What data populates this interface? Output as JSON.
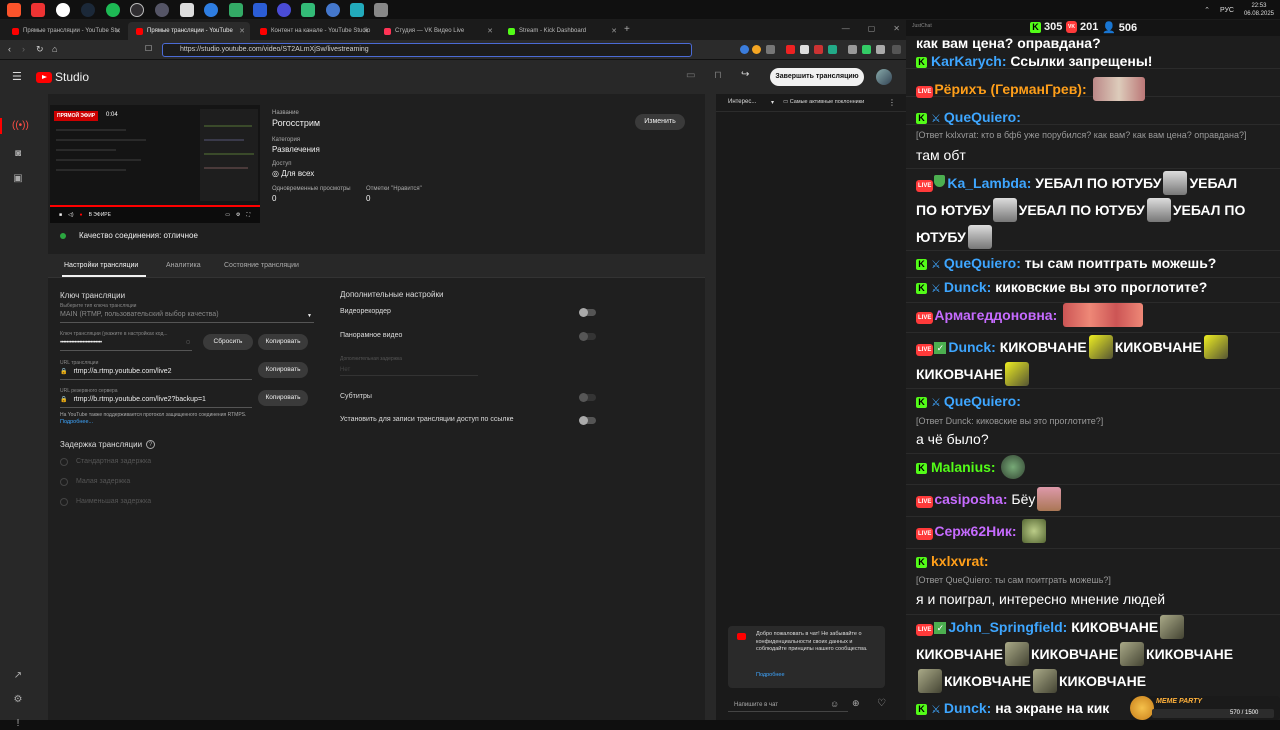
{
  "taskbar": {
    "lang": "РУС",
    "time": "22:53",
    "date": "06.08.2025"
  },
  "browser": {
    "tabs": [
      {
        "label": "Прямые трансляции - YouTube Stu",
        "active": false,
        "color": "#ff0000"
      },
      {
        "label": "Прямые трансляции - YouTube",
        "active": true,
        "color": "#ff0000"
      },
      {
        "label": "Контент на канале - YouTube Studio",
        "active": false,
        "color": "#ff0000"
      },
      {
        "label": "Студия — VK Видео Live",
        "active": false,
        "color": "#ff3355"
      },
      {
        "label": "Stream - Kick Dashboard",
        "active": false,
        "color": "#53fc18"
      }
    ],
    "url": "https://studio.youtube.com/video/ST2ALmXjSw/livestreaming"
  },
  "studio": {
    "logo_text": "Studio",
    "end_button": "Завершить трансляцию",
    "preview": {
      "badge": "ПРЯМОЙ ЭФИР",
      "time": "0:04",
      "live_label": "В ЭФИРЕ"
    },
    "info": {
      "title_label": "Название",
      "title": "Рогосстрим",
      "category_label": "Категория",
      "category": "Развлечения",
      "access_label": "Доступ",
      "access": "Для всех",
      "viewers_label": "Одновременные просмотры",
      "viewers": "0",
      "likes_label": "Отметки \"Нравится\"",
      "likes": "0"
    },
    "edit_button": "Изменить",
    "quality": "Качество соединения: отличное",
    "tabs": [
      "Настройки трансляции",
      "Аналитика",
      "Состояние трансляции"
    ],
    "key_section": {
      "title": "Ключ трансляции",
      "key_type_label": "Выберите тип ключа трансляции",
      "key_type": "MAIN (RTMP, пользовательский выбор качества)",
      "key_label": "Ключ трансляции (укажите в настройках код...",
      "key_value": "••••••••••••••••••••••••••",
      "reset_button": "Сбросить",
      "copy_button": "Копировать",
      "url_label": "URL трансляции",
      "url_value": "rtmp://a.rtmp.youtube.com/live2",
      "backup_label": "URL резервного сервера",
      "backup_value": "rtmp://b.rtmp.youtube.com/live2?backup=1",
      "rtmps_note": "На YouTube также поддерживается протокол защищенного соединения RTMPS.",
      "more_link": "Подробнее..."
    },
    "latency": {
      "title": "Задержка трансляции",
      "options": [
        "Стандартная задержка",
        "Малая задержка",
        "Наименьшая задержка"
      ]
    },
    "extra": {
      "title": "Дополнительные настройки",
      "dvr": "Видеорекордер",
      "panorama": "Панорамное видео",
      "delay_label": "Дополнительная задержка",
      "delay_value": "Нет",
      "subtitles": "Субтитры",
      "unlisted": "Установить для записи трансляции доступ по ссылке"
    },
    "chat": {
      "mode": "Интерес...",
      "top_fans": "Самые активные поклонники",
      "welcome": "Добро пожаловать в чат! Не забывайте о конфиденциальности своих данных и соблюдайте принципы нашего сообщества.",
      "welcome_link": "Подробнее",
      "input_placeholder": "Напишите в чат"
    }
  },
  "overlay": {
    "app": "JustChat",
    "kick_count": "305",
    "vk_count": "201",
    "yt_count": "506",
    "counter": "570 / 1500",
    "meme_party": "MEME PARTY",
    "colors": {
      "kick": "#53fc18",
      "kick_name": "#3ea6ff",
      "vk_name": "#c66bff",
      "orange": "#ff9f1a",
      "bg": "#1d1d1d"
    },
    "messages": [
      {
        "name": "",
        "text": "как вам цена? оправдана?"
      },
      {
        "name": "KarKarych:",
        "text": "Ссылки запрещены!"
      },
      {
        "name": "Рёрихъ (ГерманГрев):",
        "text": ""
      },
      {
        "name": "QueQuiero:",
        "text": ""
      },
      {
        "reply": "[Ответ kxlxvrat: кто в бф6 уже порубился? как вам? как вам цена? оправдана?]",
        "text": "там обт"
      },
      {
        "name": "Ka_Lambda:",
        "text": "УЕБАЛ ПО ЮТУБУ",
        "text2": "УЕБАЛ",
        "text3": "ПО ЮТУБУ",
        "text4": "УЕБАЛ ПО ЮТУБУ",
        "text5": "УЕБАЛ ПО",
        "text6": "ЮТУБУ"
      },
      {
        "name": "QueQuiero:",
        "text": "ты сам поитграть можешь?"
      },
      {
        "name": "Dunck:",
        "text": "киковские вы это проглотите?"
      },
      {
        "name": "Армагеддоновна:",
        "text": ""
      },
      {
        "name": "Dunck:",
        "text": "КИКОВЧАНЕ",
        "text2": "КИКОВЧАНЕ",
        "text3": "КИКОВЧАНЕ"
      },
      {
        "name": "QueQuiero:",
        "text": ""
      },
      {
        "reply": "[Ответ Dunck: киковские вы это проглотите?]",
        "text": "а чё было?"
      },
      {
        "name": "Malanius:",
        "text": ""
      },
      {
        "name": "casiposha:",
        "text": "Бёу"
      },
      {
        "name": "Серж62Ник:",
        "text": ""
      },
      {
        "name": "kxlxvrat:",
        "text": ""
      },
      {
        "reply": "[Ответ QueQuiero: ты сам поитграть можешь?]",
        "text": "я и поиграл, интересно мнение людей"
      },
      {
        "name": "John_Springfield:",
        "text": "КИКОВЧАНЕ",
        "text2": "КИКОВЧАНЕ",
        "text3": "КИКОВЧАНЕ",
        "text4": "КИКОВЧАНЕ",
        "text5": "КИКОВЧАНЕ",
        "text6": "КИКОВЧАНЕ"
      },
      {
        "name": "Dunck:",
        "text": "на экране на кик"
      }
    ]
  }
}
